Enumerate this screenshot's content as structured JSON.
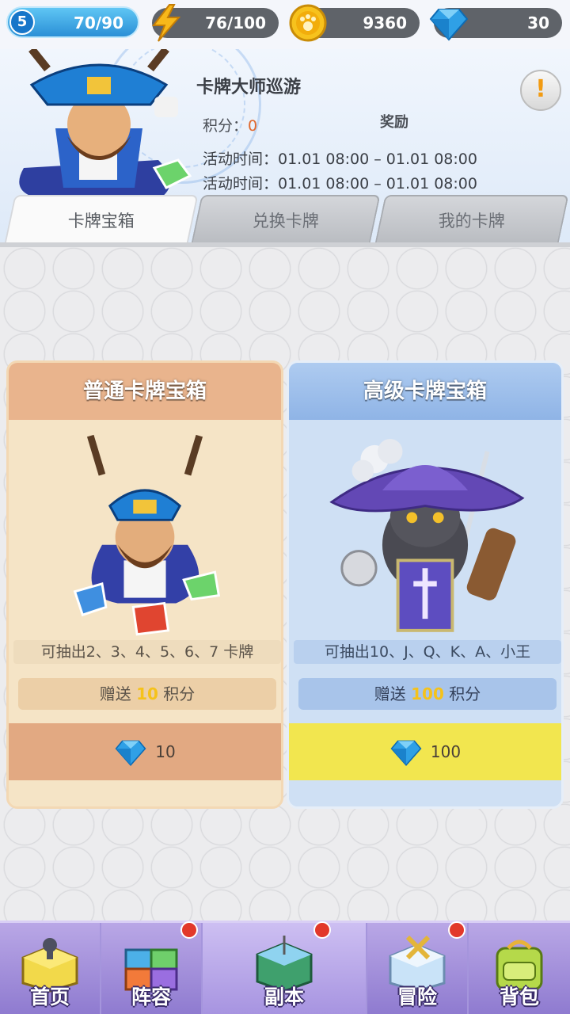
{
  "resources": {
    "level": "5",
    "exp": "70/90",
    "energy": "76/100",
    "coins": "9360",
    "gems": "30"
  },
  "event": {
    "title": "卡牌大师巡游",
    "score_label": "积分：",
    "score_value": "0",
    "reward_label": "奖励",
    "time_rows": [
      "活动时间：01.01 08:00 – 01.01 08:00",
      "活动时间：01.01 08:00 – 01.01 08:00"
    ],
    "info_icon": "!"
  },
  "tabs": [
    {
      "label": "卡牌宝箱",
      "active": true
    },
    {
      "label": "兑换卡牌",
      "active": false
    },
    {
      "label": "我的卡牌",
      "active": false
    }
  ],
  "cards": {
    "normal": {
      "title": "普通卡牌宝箱",
      "desc": "可抽出2、3、4、5、6、7 卡牌",
      "bonus_prefix": "赠送 ",
      "bonus_num": "10",
      "bonus_suffix": " 积分",
      "price": "10"
    },
    "advanced": {
      "title": "高级卡牌宝箱",
      "desc": "可抽出10、J、Q、K、A、小王",
      "bonus_prefix": "赠送 ",
      "bonus_num": "100",
      "bonus_suffix": " 积分",
      "price": "100"
    }
  },
  "nav": [
    {
      "label": "首页",
      "badge": false
    },
    {
      "label": "阵容",
      "badge": true
    },
    {
      "label": "副本",
      "badge": true,
      "active": true
    },
    {
      "label": "冒险",
      "badge": true
    },
    {
      "label": "背包",
      "badge": false
    }
  ],
  "colors": {
    "accent_blue": "#2a8fd6",
    "score_orange": "#e0672c",
    "bonus_yellow": "#f5c21b",
    "nav_purple": "#8f7bd0"
  }
}
